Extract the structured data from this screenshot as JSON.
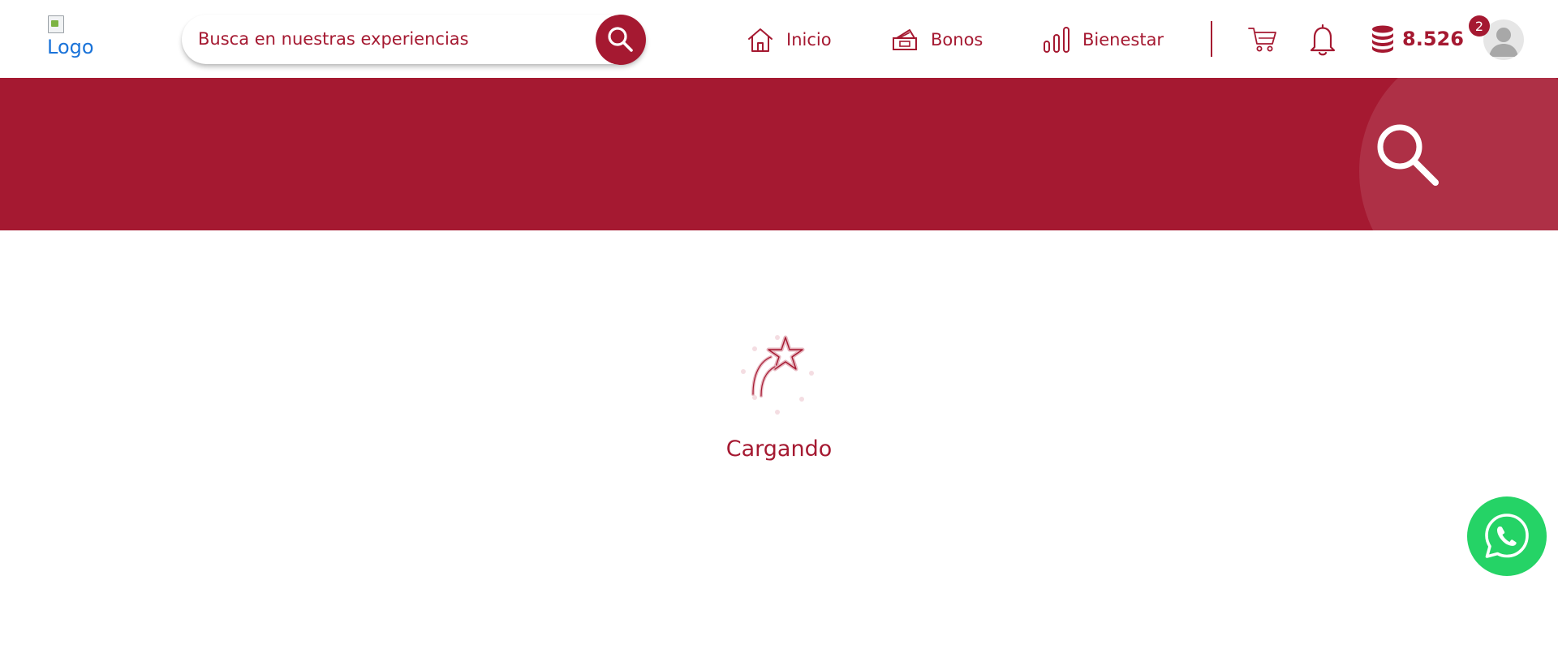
{
  "header": {
    "logo_alt": "Logo",
    "search": {
      "placeholder": "Busca en nuestras experiencias",
      "value": ""
    },
    "nav": [
      {
        "label": "Inicio",
        "icon": "home-icon"
      },
      {
        "label": "Bonos",
        "icon": "voucher-icon"
      },
      {
        "label": "Bienestar",
        "icon": "bar-chart-icon"
      }
    ],
    "points": "8.526",
    "notifications_count": "2"
  },
  "main": {
    "loading_text": "Cargando"
  },
  "colors": {
    "brand": "#a51931",
    "whatsapp": "#25d366"
  },
  "icons": [
    "search-icon",
    "home-icon",
    "voucher-icon",
    "bar-chart-icon",
    "cart-icon",
    "bell-icon",
    "coins-icon",
    "avatar-icon",
    "shooting-star-icon",
    "whatsapp-icon"
  ]
}
